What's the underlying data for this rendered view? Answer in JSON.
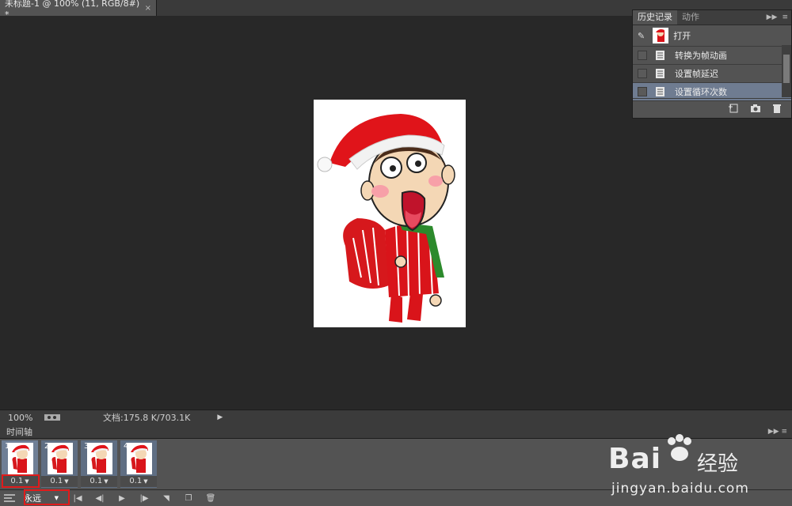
{
  "document_tab": {
    "title": "未标题-1 @ 100% (11, RGB/8#) *",
    "close_glyph": "×"
  },
  "history_panel": {
    "tabs": [
      "历史记录",
      "动作"
    ],
    "snapshot_label": "打开",
    "items": [
      "转换为帧动画",
      "设置帧延迟",
      "设置循环次数"
    ],
    "active_item_index": 2
  },
  "status_bar": {
    "zoom": "100%",
    "doc_info": "文档:175.8 K/703.1K"
  },
  "timeline": {
    "title": "时间轴",
    "frames": [
      {
        "number": "1",
        "delay": "0.1"
      },
      {
        "number": "2",
        "delay": "0.1"
      },
      {
        "number": "3",
        "delay": "0.1"
      },
      {
        "number": "4",
        "delay": "0.1"
      }
    ],
    "loop_option": "永远"
  },
  "watermark": {
    "brand": "Bai",
    "brand_suffix": "经验",
    "url": "jingyan.baidu.com"
  },
  "colors": {
    "highlight_red": "#e01b1b",
    "selection_blue": "#6f7c91"
  }
}
